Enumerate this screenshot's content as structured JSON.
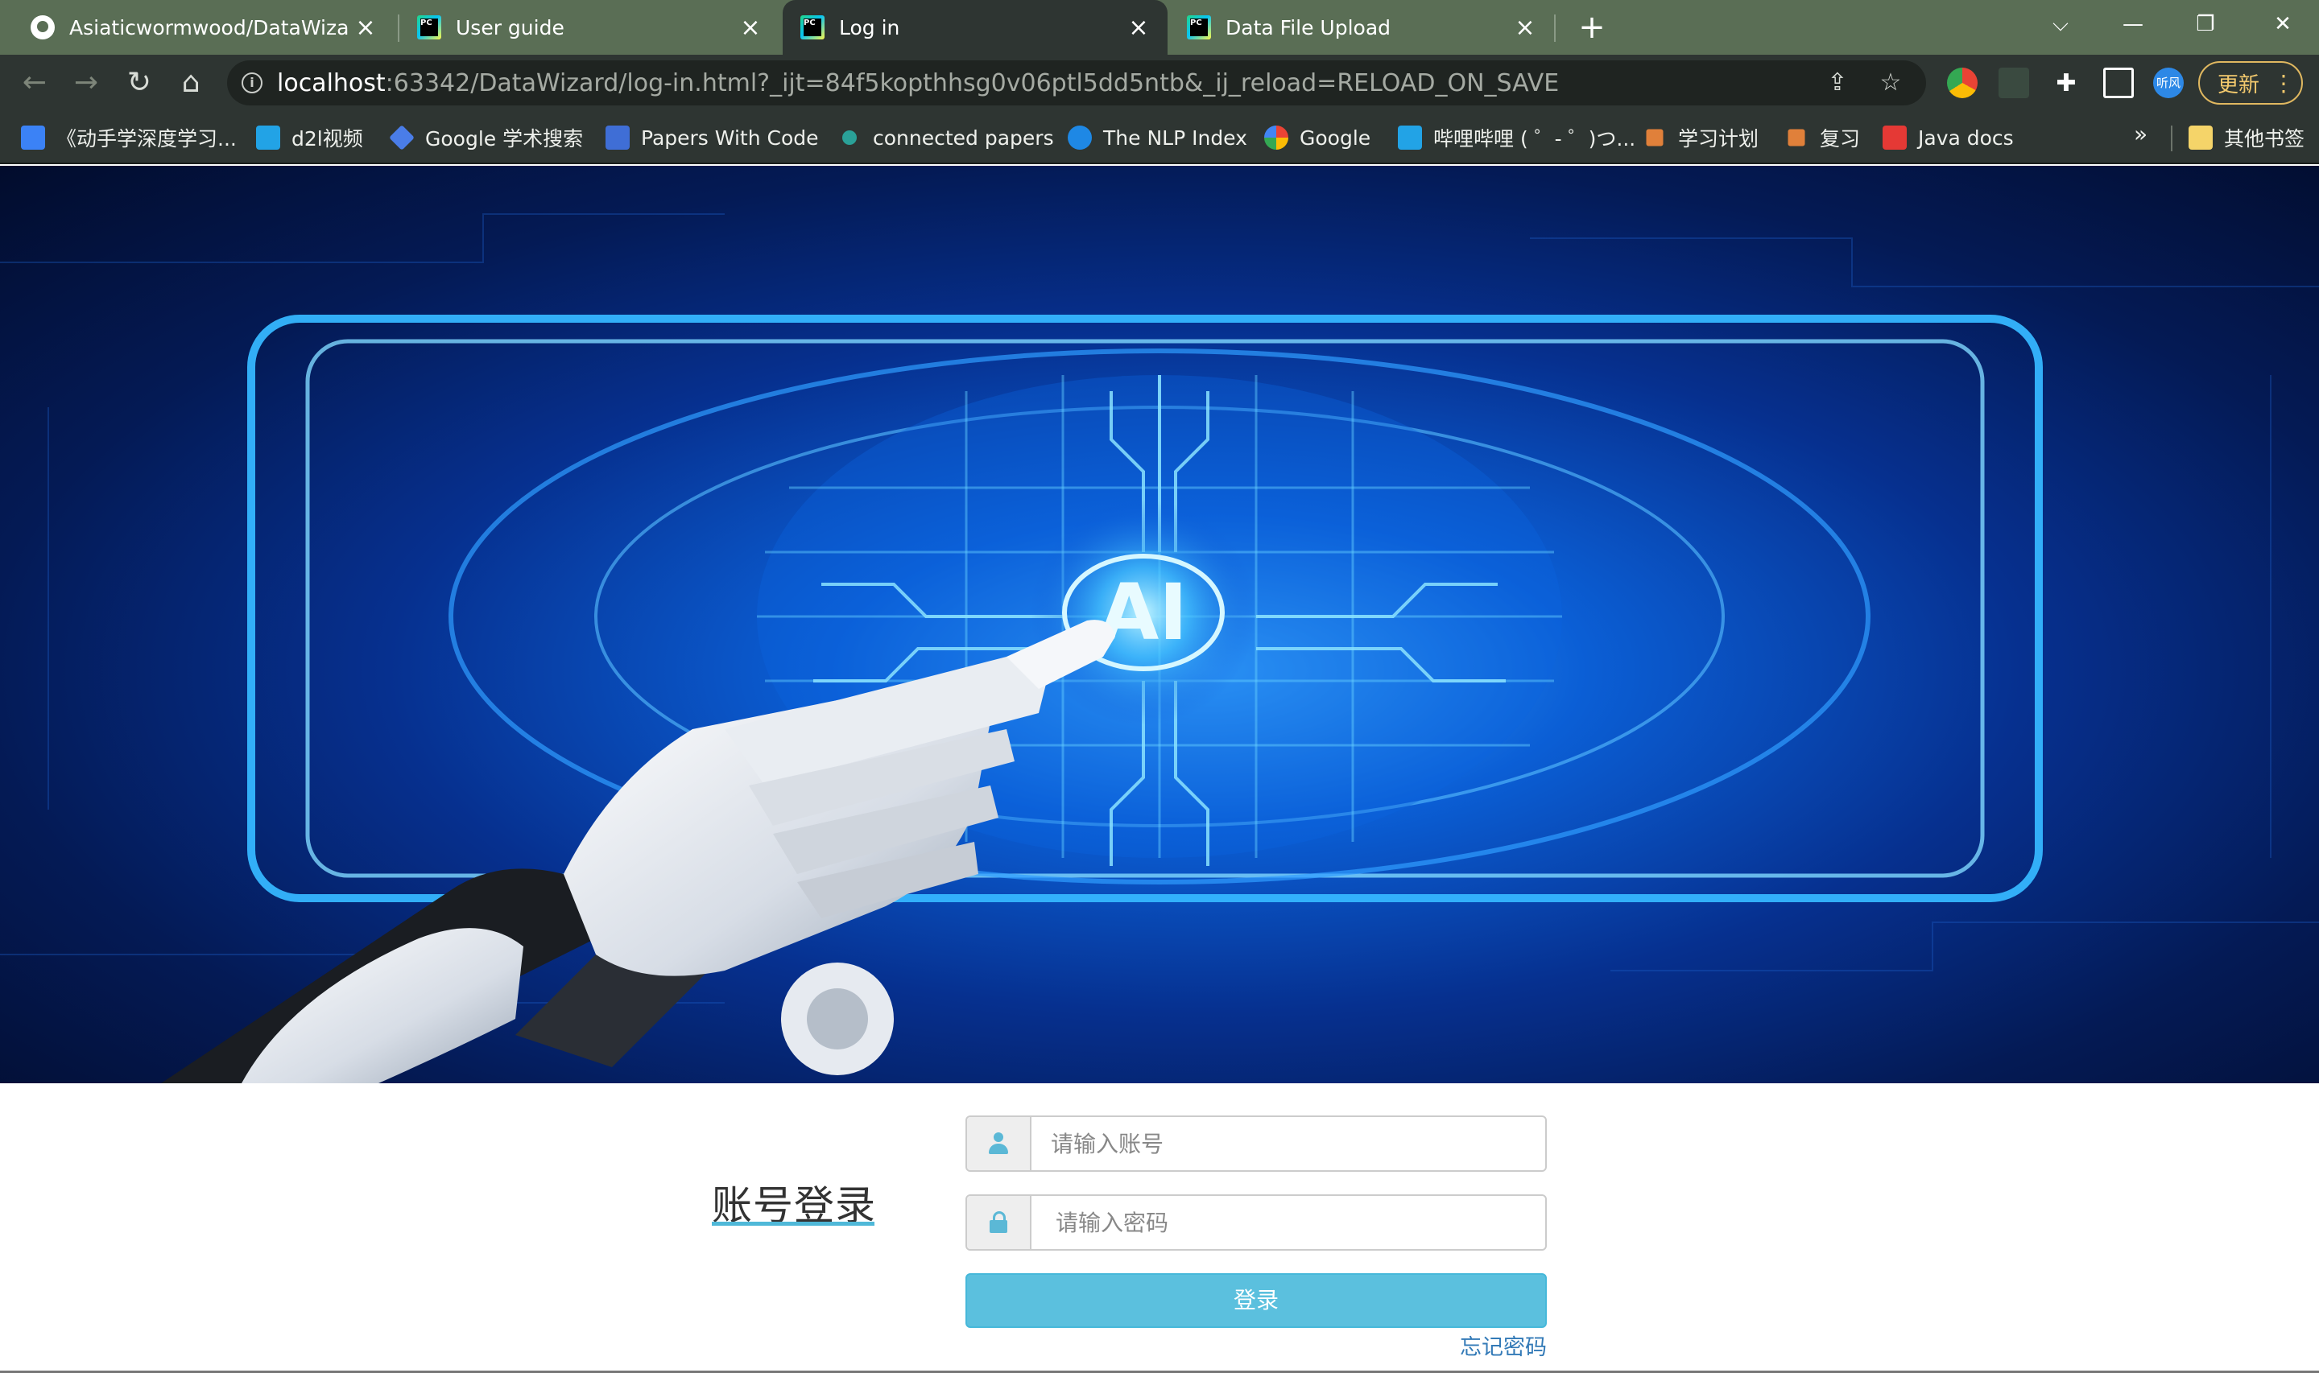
{
  "browser": {
    "tabs": [
      {
        "title": "Asiaticwormwood/DataWizard",
        "icon": "github-icon",
        "active": false
      },
      {
        "title": "User guide",
        "icon": "pycharm-icon",
        "active": false
      },
      {
        "title": "Log in",
        "icon": "pycharm-icon",
        "active": true
      },
      {
        "title": "Data File Upload",
        "icon": "pycharm-icon",
        "active": false
      }
    ],
    "new_tab": "+",
    "window_controls": {
      "dropdown": "⌵",
      "minimize": "—",
      "restore": "❐",
      "close": "✕"
    },
    "nav": {
      "back": "←",
      "forward": "→",
      "reload": "↻",
      "home": "⌂"
    },
    "url": {
      "host": "localhost",
      "rest": ":63342/DataWizard/log-in.html?_ijt=84f5kopthhsg0v06ptl5dd5ntb&_ij_reload=RELOAD_ON_SAVE"
    },
    "extension_badge": "听风",
    "update_label": "更新",
    "update_menu": "⋮",
    "bookmarks": [
      {
        "label": "《动手学深度学习...",
        "color": "#3b82f6"
      },
      {
        "label": "d2l视频",
        "color": "#22a3e6"
      },
      {
        "label": "Google 学术搜索",
        "color": "#4a7de8"
      },
      {
        "label": "Papers With Code",
        "color": "#3f6ed6"
      },
      {
        "label": "connected papers",
        "color": "#2aa198"
      },
      {
        "label": "The NLP Index",
        "color": "#1e88e5"
      },
      {
        "label": "Google",
        "color": "#ffffff"
      },
      {
        "label": "哔哩哔哩 ( ゜- ゜)つ...",
        "color": "#22a3e6"
      },
      {
        "label": "学习计划",
        "color": "#e0803a"
      },
      {
        "label": "复习",
        "color": "#e0803a"
      },
      {
        "label": "Java docs",
        "color": "#e53935"
      }
    ],
    "bookmarks_more": "»",
    "other_bookmarks": "其他书签"
  },
  "hero": {
    "logo_text": "AI"
  },
  "login": {
    "title": "账号登录",
    "username_placeholder": "请输入账号",
    "password_placeholder": "请输入密码",
    "submit_label": "登录",
    "forgot_label": "忘记密码",
    "accent_color": "#5bc0de",
    "link_color": "#337ab7"
  }
}
